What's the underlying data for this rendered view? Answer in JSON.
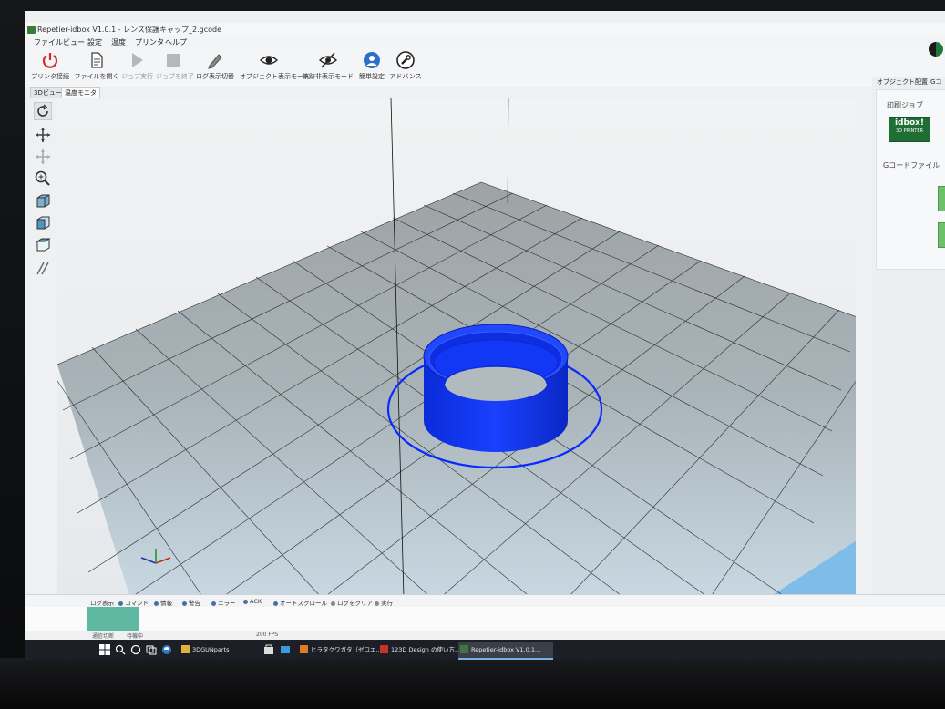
{
  "window": {
    "title": "Repetier-idbox V1.0.1 - レンズ保護キャップ_2.gcode"
  },
  "menu": [
    "ファイル",
    "ビュー",
    "設定",
    "温度",
    "プリンタ",
    "ヘルプ"
  ],
  "toolbar": {
    "connect": "プリンタ接続",
    "open_file": "ファイルを開く",
    "run_job": "ジョブ実行",
    "end_job": "ジョブを終了",
    "log_toggle": "ログ表示切替",
    "object_view": "オブジェクト表示モード",
    "path_hide": "軌跡非表示モード",
    "easy_settings": "簡単設定",
    "advanced": "アドバンス"
  },
  "subtabs": [
    "3Dビュー",
    "温度モニタ"
  ],
  "right_panel": {
    "tabs": [
      "オブジェクト配置",
      "Gコ"
    ],
    "print_job": "印刷ジョブ",
    "logo_main": "idbox!",
    "logo_sub": "3D PRINTER",
    "gcode_file": "Gコードファイル"
  },
  "log_options": [
    "ログ表示",
    "コマンド",
    "情報",
    "警告",
    "エラー",
    "ACK",
    "オートスクロール",
    "ログをクリア",
    "実行"
  ],
  "status": {
    "left": "通信切断",
    "mid": "待機中",
    "fps": "200 FPS"
  },
  "taskbar": {
    "items": [
      "3DGUNparts",
      "ヒラタクワガタ（ゼロエ...",
      "123D Design の使い方...",
      "Repetier-idbox V1.0.1..."
    ]
  },
  "colors": {
    "object": "#0a2bff",
    "grid": "#8b9296",
    "accent": "#1f6f35"
  }
}
